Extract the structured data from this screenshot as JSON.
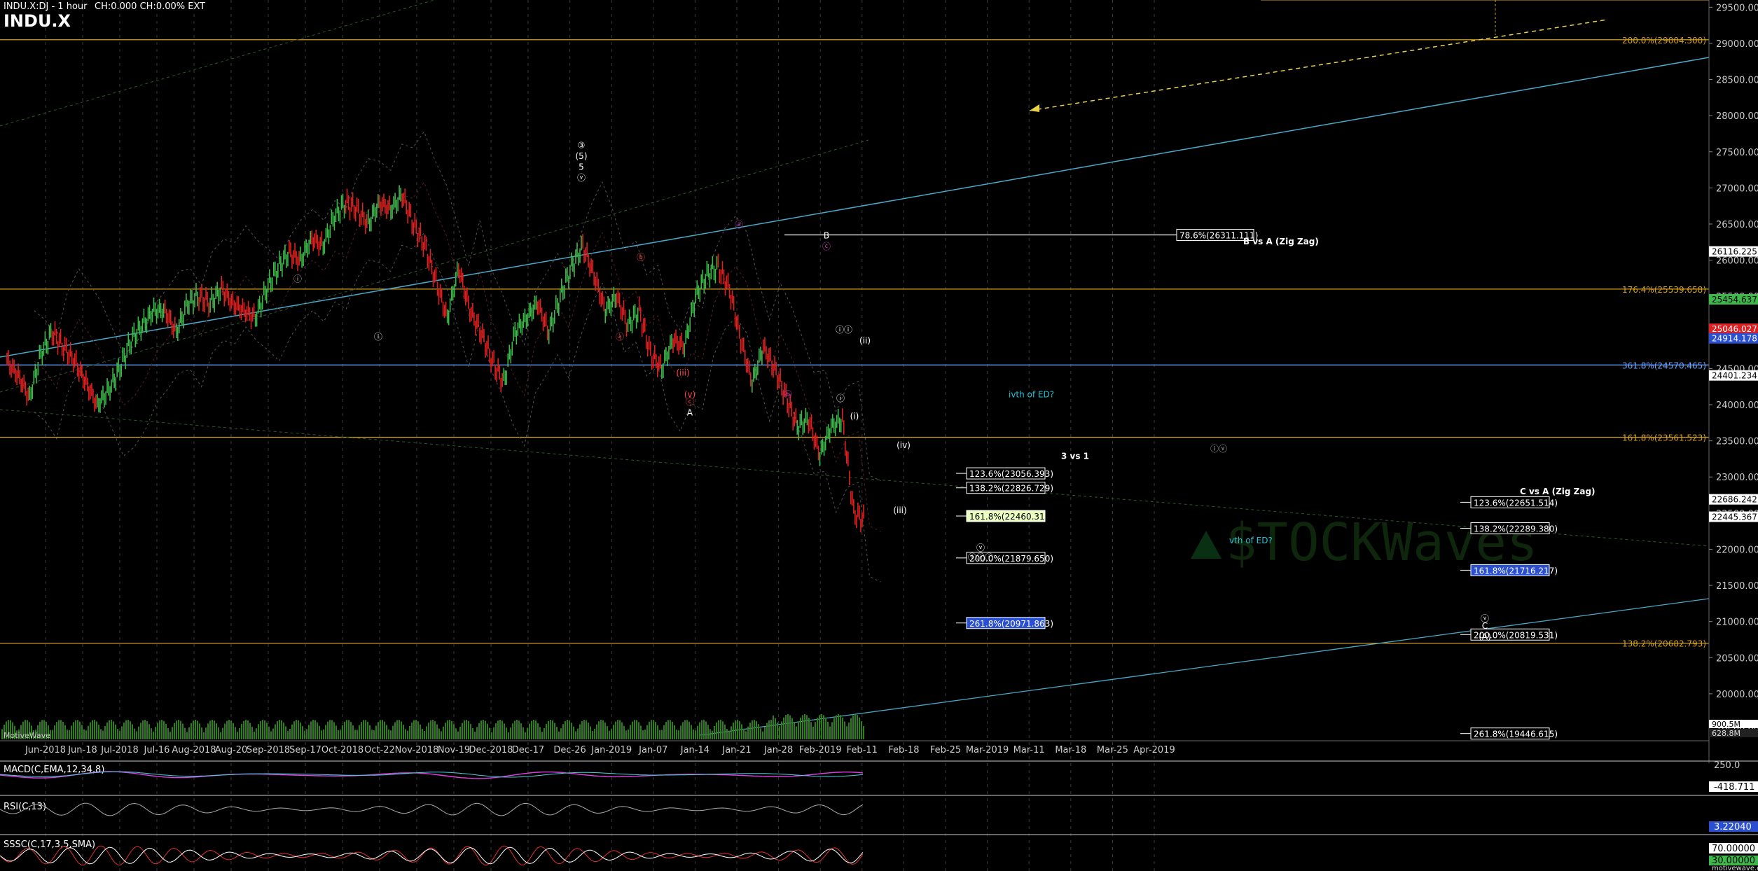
{
  "header": {
    "symbol_line": "INDU.X:DJ - 1 hour",
    "change_text": "CH:0.000 CH:0.00% EXT",
    "title": "INDU.X"
  },
  "chart_data": {
    "type": "line",
    "title": "INDU.X",
    "subtitle": "INDU.X:DJ - 1 hour",
    "ylim": [
      19350,
      29600
    ],
    "x_ticks": [
      "Jun-2018",
      "Jun-18",
      "Jul-2018",
      "Jul-16",
      "Aug-2018",
      "Aug-20",
      "Sep-2018",
      "Sep-17",
      "Oct-2018",
      "Oct-22",
      "Nov-2018",
      "Nov-19",
      "Dec-2018",
      "Dec-17",
      "Dec-26",
      "Jan-2019",
      "Jan-07",
      "Jan-14",
      "Jan-21",
      "Jan-28",
      "Feb-2019",
      "Feb-11",
      "Feb-18",
      "Feb-25",
      "Mar-2019",
      "Mar-11",
      "Mar-18",
      "Mar-25",
      "Apr-2019"
    ],
    "y_ticks": [
      "29500.000",
      "29000.000",
      "28500.000",
      "28000.000",
      "27500.000",
      "27000.000",
      "26500.000",
      "26000.000",
      "25500.000",
      "25000.000",
      "24500.000",
      "24000.000",
      "23500.000",
      "23000.000",
      "22500.000",
      "22000.000",
      "21500.000",
      "21000.000",
      "20500.000",
      "20000.000",
      "19500.000"
    ],
    "price_series": {
      "name": "INDU.X",
      "points": [
        [
          0,
          24600
        ],
        [
          0.5,
          24400
        ],
        [
          1,
          24100
        ],
        [
          1.5,
          24700
        ],
        [
          2,
          25000
        ],
        [
          2.5,
          24800
        ],
        [
          3,
          24600
        ],
        [
          3.5,
          24300
        ],
        [
          4,
          24000
        ],
        [
          4.5,
          24200
        ],
        [
          5,
          24500
        ],
        [
          5.5,
          24900
        ],
        [
          6,
          25100
        ],
        [
          6.5,
          25300
        ],
        [
          7,
          25300
        ],
        [
          7.5,
          25000
        ],
        [
          8,
          25400
        ],
        [
          8.5,
          25500
        ],
        [
          9,
          25400
        ],
        [
          9.5,
          25600
        ],
        [
          10,
          25400
        ],
        [
          10.5,
          25300
        ],
        [
          11,
          25200
        ],
        [
          11.5,
          25600
        ],
        [
          12,
          25900
        ],
        [
          12.5,
          26100
        ],
        [
          13,
          26000
        ],
        [
          13.5,
          26300
        ],
        [
          14,
          26200
        ],
        [
          14.5,
          26600
        ],
        [
          15,
          26800
        ],
        [
          15.5,
          26700
        ],
        [
          16,
          26500
        ],
        [
          16.5,
          26800
        ],
        [
          17,
          26700
        ],
        [
          17.5,
          26900
        ],
        [
          18,
          26500
        ],
        [
          18.5,
          26200
        ],
        [
          19,
          25700
        ],
        [
          19.5,
          25200
        ],
        [
          20,
          25900
        ],
        [
          20.5,
          25300
        ],
        [
          21,
          25000
        ],
        [
          21.5,
          24600
        ],
        [
          22,
          24300
        ],
        [
          22.5,
          25000
        ],
        [
          23,
          25200
        ],
        [
          23.5,
          25400
        ],
        [
          24,
          25000
        ],
        [
          24.5,
          25500
        ],
        [
          25,
          25900
        ],
        [
          25.5,
          26200
        ],
        [
          26,
          25800
        ],
        [
          26.5,
          25300
        ],
        [
          27,
          25500
        ],
        [
          27.5,
          25100
        ],
        [
          28,
          25300
        ],
        [
          28.5,
          24700
        ],
        [
          29,
          24500
        ],
        [
          29.5,
          24900
        ],
        [
          30,
          24800
        ],
        [
          30.5,
          25500
        ],
        [
          31,
          25800
        ],
        [
          31.5,
          25900
        ],
        [
          32,
          25600
        ],
        [
          32.5,
          24900
        ],
        [
          33,
          24300
        ],
        [
          33.5,
          24800
        ],
        [
          34,
          24500
        ],
        [
          34.5,
          24100
        ],
        [
          35,
          23700
        ],
        [
          35.5,
          23800
        ],
        [
          36,
          23300
        ],
        [
          36.5,
          23700
        ],
        [
          37,
          23800
        ],
        [
          37.5,
          22500
        ],
        [
          38,
          22400
        ]
      ]
    },
    "volume_label": "MotiveWave",
    "horizontal_levels": [
      {
        "value": 29050,
        "label": "200.0%(29004.300)",
        "color": "#d4a017"
      },
      {
        "value": 26350,
        "label": "78.6%(26311.111)",
        "color": "#ffffff"
      },
      {
        "value": 25600,
        "label": "176.4%(25539.658)",
        "color": "#d4a017"
      },
      {
        "value": 24550,
        "label": "361.8%(24570.465)",
        "color": "#6aa4ff"
      },
      {
        "value": 23550,
        "label": "161.8%(23561.523)",
        "color": "#d4a017"
      },
      {
        "value": 20700,
        "label": "138.2%(20682.793)",
        "color": "#d4a017"
      }
    ],
    "fib_boxes": [
      {
        "x": 26.8,
        "value": 23050,
        "label": "123.6%(23056.393)",
        "style": "plain"
      },
      {
        "x": 26.8,
        "value": 22850,
        "label": "138.2%(22826.729)",
        "style": "plain"
      },
      {
        "x": 26.8,
        "value": 22460,
        "label": "161.8%(22460.316)",
        "style": "green"
      },
      {
        "x": 26.8,
        "value": 21880,
        "label": "200.0%(21879.650)",
        "style": "plain"
      },
      {
        "x": 26.8,
        "value": 20980,
        "label": "261.8%(20971.863)",
        "style": "blue"
      },
      {
        "x": 41.2,
        "value": 22650,
        "label": "123.6%(22651.514)",
        "style": "plain"
      },
      {
        "x": 41.2,
        "value": 22290,
        "label": "138.2%(22289.380)",
        "style": "plain"
      },
      {
        "x": 41.2,
        "value": 21710,
        "label": "161.8%(21716.217)",
        "style": "blue"
      },
      {
        "x": 41.2,
        "value": 20820,
        "label": "200.0%(20819.531)",
        "style": "plain"
      },
      {
        "x": 41.2,
        "value": 19450,
        "label": "261.8%(19446.615)",
        "style": "plain"
      }
    ],
    "annotations": [
      {
        "text": "3 vs 1",
        "x": 29.5,
        "value": 23250,
        "color": "#ffffff"
      },
      {
        "text": "B vs A (Zig Zag)",
        "x": 34.7,
        "value": 26220,
        "color": "#ffffff"
      },
      {
        "text": "C vs A (Zig Zag)",
        "x": 42.6,
        "value": 22760,
        "color": "#ffffff"
      },
      {
        "text": "ivth of ED?",
        "x": 28.0,
        "value": 24100,
        "color": "#22c4d4"
      },
      {
        "text": "vth of ED?",
        "x": 34.3,
        "value": 22080,
        "color": "#22c4d4"
      }
    ],
    "wave_labels": [
      {
        "text": "③",
        "x": 15.8,
        "value": 27550,
        "color": "#ffffff"
      },
      {
        "text": "(5)",
        "x": 15.8,
        "value": 27400,
        "color": "#ffffff"
      },
      {
        "text": "5",
        "x": 15.8,
        "value": 27250,
        "color": "#ffffff"
      },
      {
        "text": "ⓥ",
        "x": 15.8,
        "value": 27100,
        "color": "#ffffff"
      },
      {
        "text": "ⓘ",
        "x": 7.7,
        "value": 25700,
        "color": "#bbbbbb"
      },
      {
        "text": "ⓘ",
        "x": 10.0,
        "value": 24900,
        "color": "#ffffff"
      },
      {
        "text": "ⓐ",
        "x": 16.9,
        "value": 24900,
        "color": "#ff4444"
      },
      {
        "text": "ⓑ",
        "x": 17.5,
        "value": 26000,
        "color": "#ff4444"
      },
      {
        "text": "(iii)",
        "x": 18.7,
        "value": 24400,
        "color": "#ff4444"
      },
      {
        "text": "(v)",
        "x": 18.9,
        "value": 24100,
        "color": "#ff4444"
      },
      {
        "text": "ⓒ",
        "x": 18.9,
        "value": 24000,
        "color": "#ff4444"
      },
      {
        "text": "A",
        "x": 18.9,
        "value": 23850,
        "color": "#ffffff"
      },
      {
        "text": "ⓐ",
        "x": 20.3,
        "value": 26450,
        "color": "#cc44cc"
      },
      {
        "text": "ⓑ",
        "x": 21.7,
        "value": 24100,
        "color": "#cc44cc"
      },
      {
        "text": "B",
        "x": 22.8,
        "value": 26300,
        "color": "#ffffff"
      },
      {
        "text": "ⓒ",
        "x": 22.8,
        "value": 26150,
        "color": "#cc44cc"
      },
      {
        "text": "ⓘ",
        "x": 23.2,
        "value": 24050,
        "color": "#ffffff"
      },
      {
        "text": "ⓘⓘ",
        "x": 23.3,
        "value": 25000,
        "color": "#ffffff"
      },
      {
        "text": "(ii)",
        "x": 23.9,
        "value": 24850,
        "color": "#ffffff"
      },
      {
        "text": "(i)",
        "x": 23.6,
        "value": 23800,
        "color": "#ffffff"
      },
      {
        "text": "(iv)",
        "x": 25.0,
        "value": 23400,
        "color": "#ffffff"
      },
      {
        "text": "(iii)",
        "x": 24.9,
        "value": 22500,
        "color": "#ffffff"
      },
      {
        "text": "ⓥ",
        "x": 27.2,
        "value": 21980,
        "color": "#ffffff"
      },
      {
        "text": "ⓘⓘⓘ",
        "x": 27.2,
        "value": 21850,
        "color": "#ffffff"
      },
      {
        "text": "ⓘⓥ",
        "x": 34.0,
        "value": 23350,
        "color": "#bbbbbb"
      },
      {
        "text": "ⓥ",
        "x": 41.6,
        "value": 21000,
        "color": "#ffffff"
      },
      {
        "text": "C",
        "x": 41.6,
        "value": 20900,
        "color": "#ffffff"
      },
      {
        "text": "(A)",
        "x": 41.6,
        "value": 20750,
        "color": "#ffffff"
      }
    ],
    "right_badges": [
      {
        "value": 26116,
        "label": "26116.225",
        "bg": "#ffffff",
        "fg": "#000000"
      },
      {
        "value": 25454,
        "label": "25454.637",
        "bg": "#3db84a",
        "fg": "#000000"
      },
      {
        "value": 25046,
        "label": "25046.027",
        "bg": "#e02020",
        "fg": "#ffffff"
      },
      {
        "value": 24914,
        "label": "24914.178",
        "bg": "#2a4fd0",
        "fg": "#ffffff"
      },
      {
        "value": 24401,
        "label": "24401.234",
        "bg": "#ffffff",
        "fg": "#000000"
      },
      {
        "value": 22686,
        "label": "22686.242",
        "bg": "#ffffff",
        "fg": "#000000"
      },
      {
        "value": 22445,
        "label": "22445.367",
        "bg": "#ffffff",
        "fg": "#000000"
      }
    ],
    "volume_axis": [
      "900.5M",
      "628.8M"
    ],
    "macd": {
      "label": "MACD(C,EMA,12,34,8)",
      "axis": "250.0",
      "value": "-418.711"
    },
    "rsi": {
      "label": "RSI(C,13)",
      "value": "3.22040"
    },
    "sssc": {
      "label": "SSSC(C,17,3,5,SMA)",
      "value_top": "70.00000",
      "value_bottom": "30.00000"
    },
    "watermark": "$TOCKWaves",
    "footer_brand": "motivewave.com"
  },
  "colors": {
    "background": "#000000",
    "grid": "#555555",
    "fib_gold": "#d4a017",
    "trend_blue": "#4aa8c8",
    "volume_green": "#2e7d1e"
  }
}
